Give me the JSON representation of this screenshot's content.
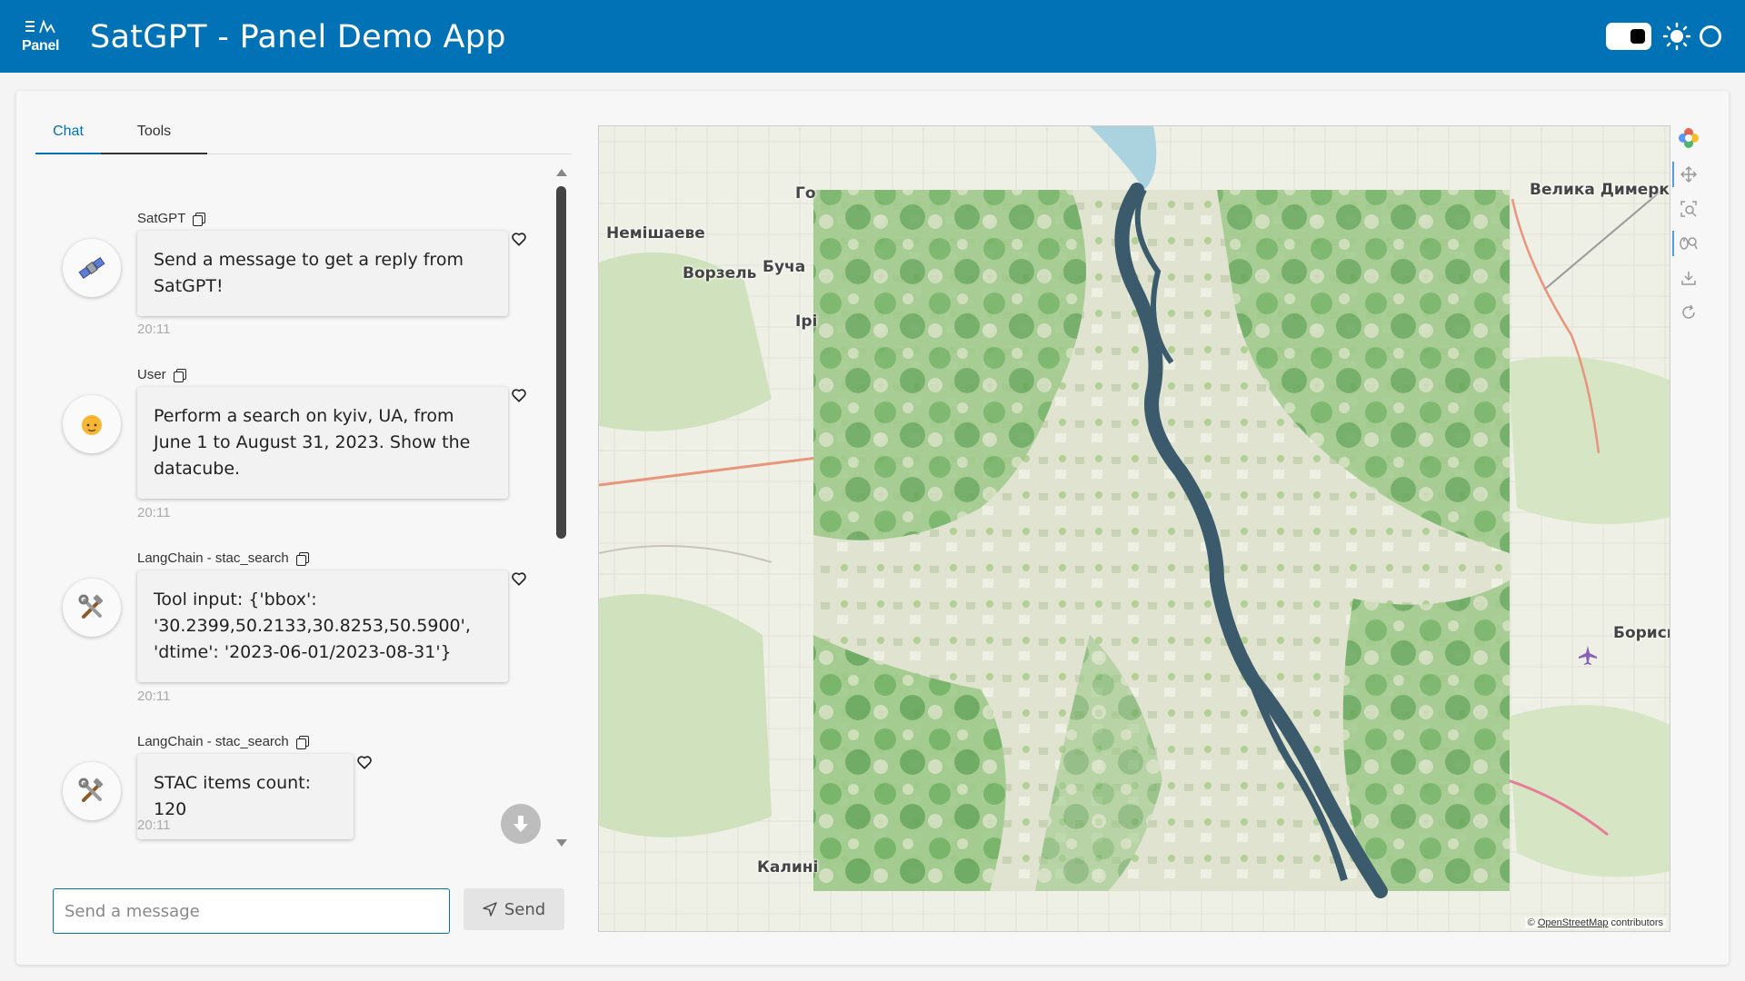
{
  "header": {
    "logo_text": "Panel",
    "title": "SatGPT - Panel Demo App",
    "icons": [
      "menu-lines-icon",
      "theme-toggle",
      "sun-icon",
      "circle-icon"
    ]
  },
  "tabs": [
    {
      "label": "Chat",
      "active": true
    },
    {
      "label": "Tools",
      "active": false
    }
  ],
  "messages": [
    {
      "author": "SatGPT",
      "avatar": "satellite-icon",
      "text": "Send a message to get a reply from SatGPT!",
      "time": "20:11"
    },
    {
      "author": "User",
      "avatar": "person-icon",
      "text": "Perform a search on kyiv, UA, from June 1 to August 31, 2023. Show the datacube.",
      "time": "20:11"
    },
    {
      "author": "LangChain - stac_search",
      "avatar": "tools-icon",
      "text": "Tool input: {'bbox': '30.2399,50.2133,30.8253,50.5900', 'dtime': '2023-06-01/2023-08-31'}",
      "time": "20:11"
    },
    {
      "author": "LangChain - stac_search",
      "avatar": "tools-icon",
      "text": "STAC items count: 120",
      "time": "20:11"
    }
  ],
  "input": {
    "placeholder": "Send a message",
    "value": ""
  },
  "send_button": {
    "label": "Send"
  },
  "map": {
    "labels": [
      "Го",
      "Немішаеве",
      "Ворзель",
      "Буча",
      "Ірі",
      "Велика Димерка",
      "Бориспі",
      "Калині"
    ],
    "attribution_link": "OpenStreetMap",
    "attribution_suffix": " contributors",
    "attribution_prefix": "© "
  },
  "colors": {
    "header": "#0072b5",
    "accent": "#0072b5",
    "river": "#3b5a6b",
    "vegetation": "#5aa54f"
  }
}
